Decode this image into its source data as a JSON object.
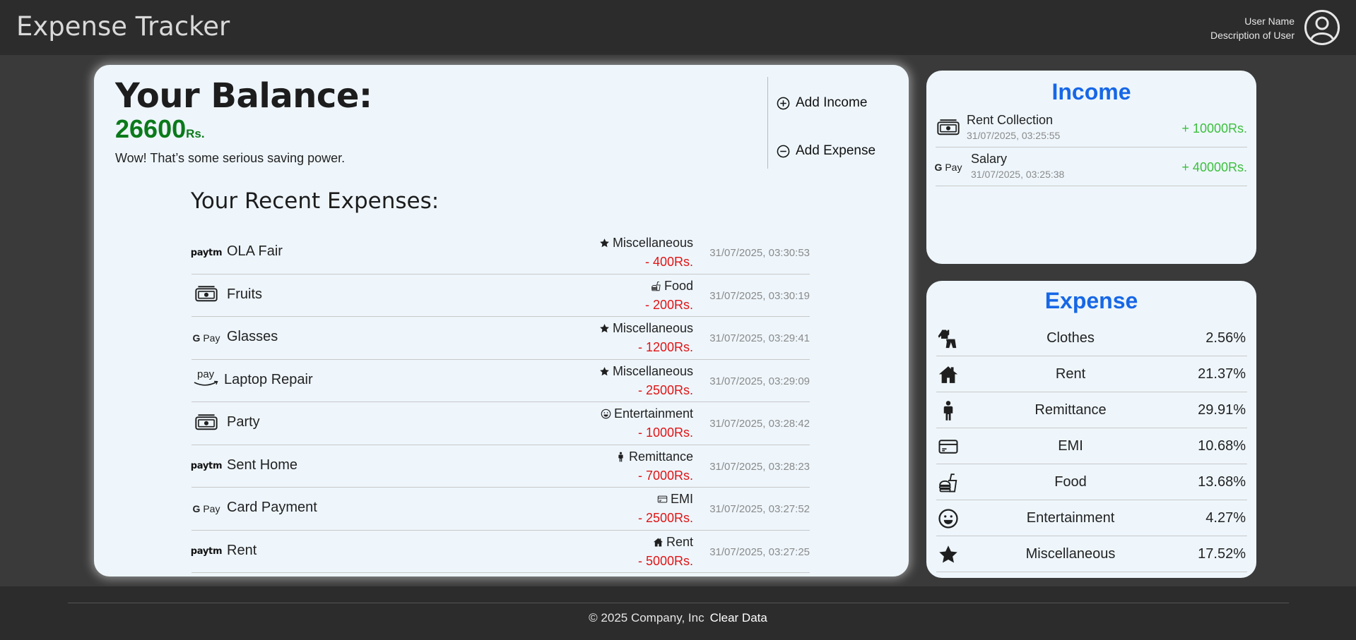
{
  "header": {
    "title": "Expense Tracker",
    "user_name": "User Name",
    "user_description": "Description of User"
  },
  "balance": {
    "title": "Your Balance:",
    "amount": "26600",
    "unit": "Rs.",
    "message": "Wow! That’s some serious saving power."
  },
  "actions": {
    "add_income": "Add Income",
    "add_expense": "Add Expense"
  },
  "recent": {
    "title": "Your Recent Expenses:",
    "items": [
      {
        "name": "OLA Fair",
        "method": "paytm",
        "category": "Miscellaneous",
        "category_icon": "star-icon",
        "amount": "- 400Rs.",
        "date": "31/07/2025, 03:30:53"
      },
      {
        "name": "Fruits",
        "method": "cash",
        "category": "Food",
        "category_icon": "food-icon",
        "amount": "- 200Rs.",
        "date": "31/07/2025, 03:30:19"
      },
      {
        "name": "Glasses",
        "method": "gpay",
        "category": "Miscellaneous",
        "category_icon": "star-icon",
        "amount": "- 1200Rs.",
        "date": "31/07/2025, 03:29:41"
      },
      {
        "name": "Laptop Repair",
        "method": "amazonpay",
        "category": "Miscellaneous",
        "category_icon": "star-icon",
        "amount": "- 2500Rs.",
        "date": "31/07/2025, 03:29:09"
      },
      {
        "name": "Party",
        "method": "cash",
        "category": "Entertainment",
        "category_icon": "smile-icon",
        "amount": "- 1000Rs.",
        "date": "31/07/2025, 03:28:42"
      },
      {
        "name": "Sent Home",
        "method": "paytm",
        "category": "Remittance",
        "category_icon": "person-icon",
        "amount": "- 7000Rs.",
        "date": "31/07/2025, 03:28:23"
      },
      {
        "name": "Card Payment",
        "method": "gpay",
        "category": "EMI",
        "category_icon": "card-icon",
        "amount": "- 2500Rs.",
        "date": "31/07/2025, 03:27:52"
      },
      {
        "name": "Rent",
        "method": "paytm",
        "category": "Rent",
        "category_icon": "house-icon",
        "amount": "- 5000Rs.",
        "date": "31/07/2025, 03:27:25"
      }
    ]
  },
  "income": {
    "title": "Income",
    "items": [
      {
        "name": "Rent Collection",
        "method": "cash",
        "date": "31/07/2025, 03:25:55",
        "amount": "+ 10000Rs."
      },
      {
        "name": "Salary",
        "method": "gpay",
        "date": "31/07/2025, 03:25:38",
        "amount": "+ 40000Rs."
      }
    ]
  },
  "expense_breakdown": {
    "title": "Expense",
    "items": [
      {
        "label": "Clothes",
        "icon": "clothes-icon",
        "percent": "2.56%"
      },
      {
        "label": "Rent",
        "icon": "house-icon",
        "percent": "21.37%"
      },
      {
        "label": "Remittance",
        "icon": "person-icon",
        "percent": "29.91%"
      },
      {
        "label": "EMI",
        "icon": "card-icon",
        "percent": "10.68%"
      },
      {
        "label": "Food",
        "icon": "food-icon",
        "percent": "13.68%"
      },
      {
        "label": "Entertainment",
        "icon": "smile-icon",
        "percent": "4.27%"
      },
      {
        "label": "Miscellaneous",
        "icon": "star-icon",
        "percent": "17.52%"
      }
    ]
  },
  "payment_logos": {
    "paytm": "paytm",
    "gpay_g": "G",
    "gpay_pay": "Pay",
    "amazonpay": "pay"
  },
  "footer": {
    "copyright": "© 2025 Company, Inc",
    "clear_data": "Clear Data"
  },
  "colors": {
    "balance_green": "#0b7a1a",
    "expense_red": "#e01414",
    "income_green": "#3cbf3c",
    "heading_blue": "#1767e6",
    "card_bg": "#eef6fc"
  }
}
